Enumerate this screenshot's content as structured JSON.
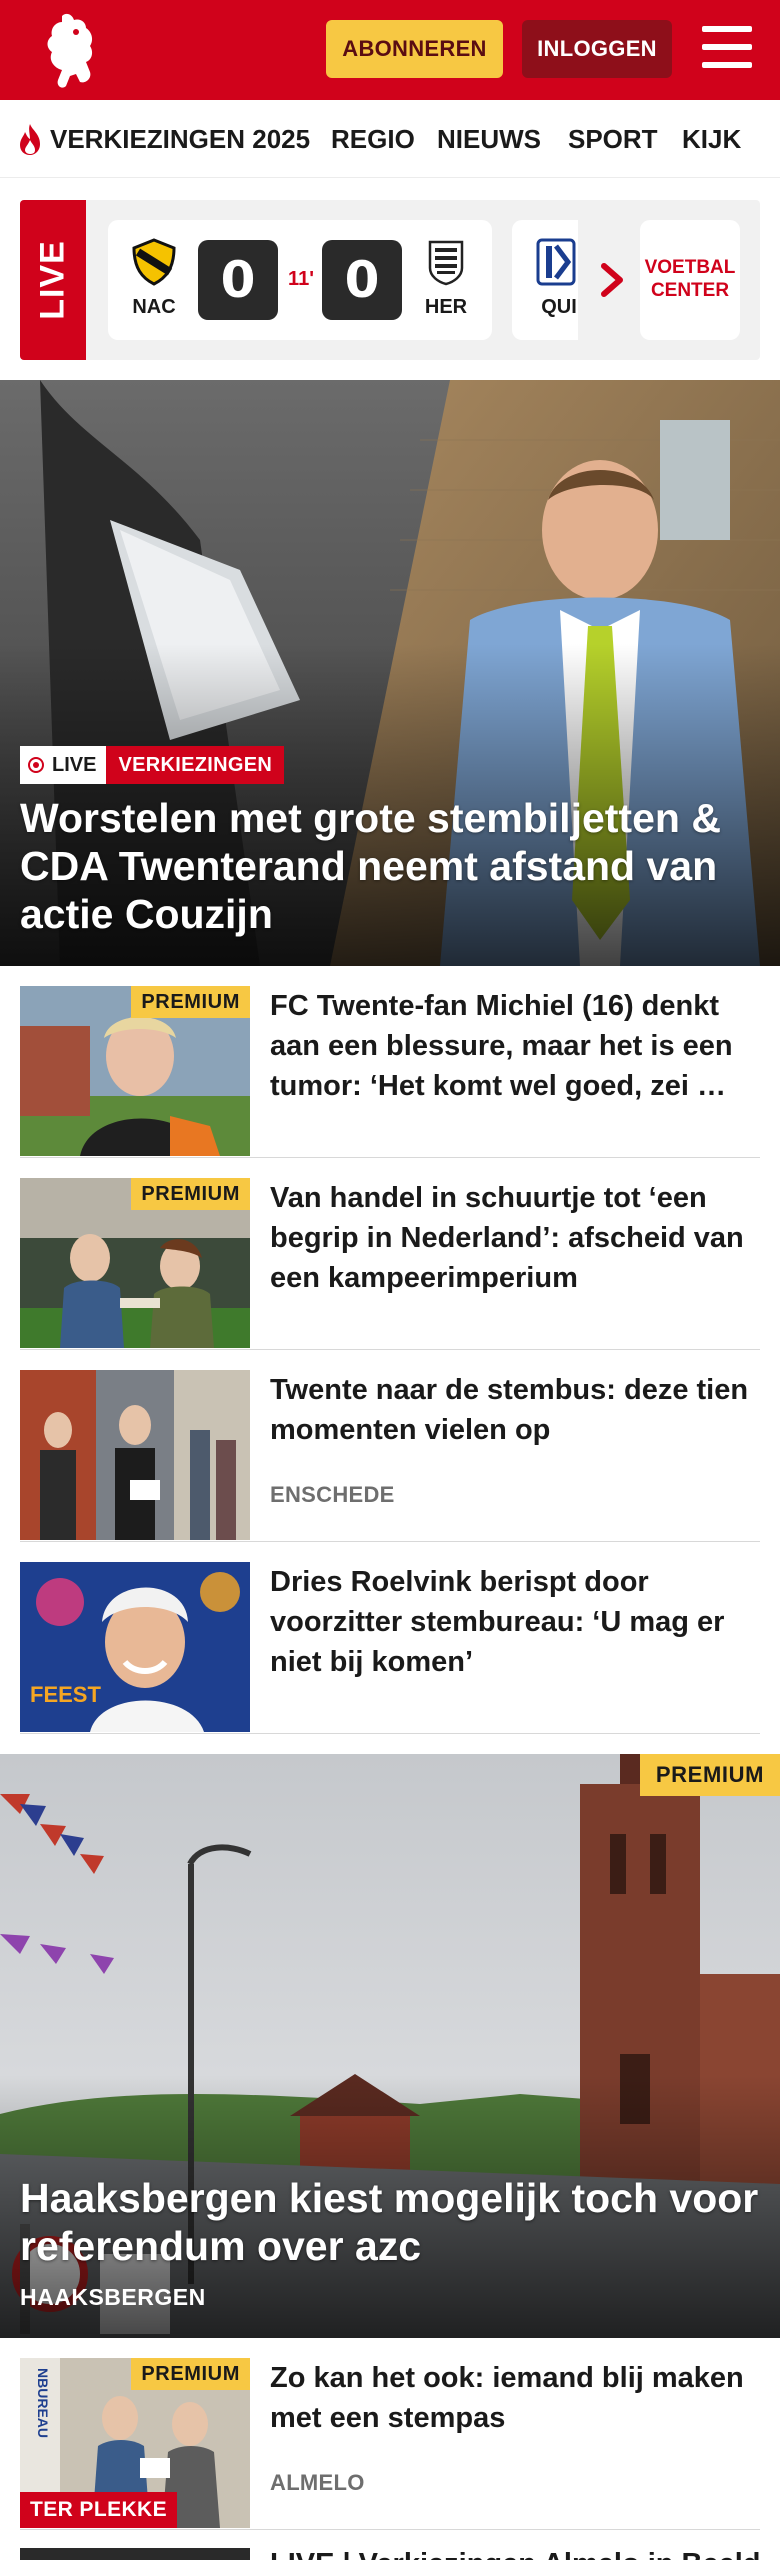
{
  "header": {
    "subscribe_label": "ABONNEREN",
    "login_label": "INLOGGEN",
    "brand_color": "#d0021b"
  },
  "nav": {
    "items": [
      {
        "label": "VERKIEZINGEN 2025",
        "icon": "flame-icon"
      },
      {
        "label": "REGIO"
      },
      {
        "label": "NIEUWS"
      },
      {
        "label": "SPORT"
      },
      {
        "label": "KIJK"
      }
    ]
  },
  "live_scores": {
    "tab_label": "LIVE",
    "match": {
      "home": "NAC",
      "away": "HER",
      "home_score": "0",
      "away_score": "0",
      "minute": "11'"
    },
    "next_match_home": "QUI",
    "center_label": "VOETBAL CENTER"
  },
  "hero": {
    "live_label": "LIVE",
    "category": "VERKIEZINGEN",
    "title": "Worstelen met grote stembiljetten & CDA Twenterand neemt afstand van actie Couzijn"
  },
  "articles": [
    {
      "premium": "PREMIUM",
      "title": "FC Twente-fan Michiel (16) denkt aan een blessure, maar het is een tumor: ‘Het komt wel goed, zei …",
      "location": ""
    },
    {
      "premium": "PREMIUM",
      "title": "Van handel in schuurtje tot ‘een begrip in Nederland’: afscheid van een kampeerimperium",
      "location": ""
    },
    {
      "premium": "",
      "title": "Twente naar de stembus: deze tien momenten vielen op",
      "location": "ENSCHEDE"
    },
    {
      "premium": "",
      "title": "Dries Roelvink berispt door voorzitter stembureau: ‘U mag er niet bij komen’",
      "location": ""
    }
  ],
  "feature": {
    "premium": "PREMIUM",
    "title": "Haaksbergen kiest mogelijk toch voor referendum over azc",
    "location": "HAAKSBERGEN"
  },
  "article_after": {
    "premium": "PREMIUM",
    "title": "Zo kan het ook: iemand blij maken met een stempas",
    "location": "ALMELO",
    "tag": "TER PLEKKE"
  },
  "partial_next": {
    "title": "LIVE | Verkiezingen Almelo in Beeld"
  }
}
